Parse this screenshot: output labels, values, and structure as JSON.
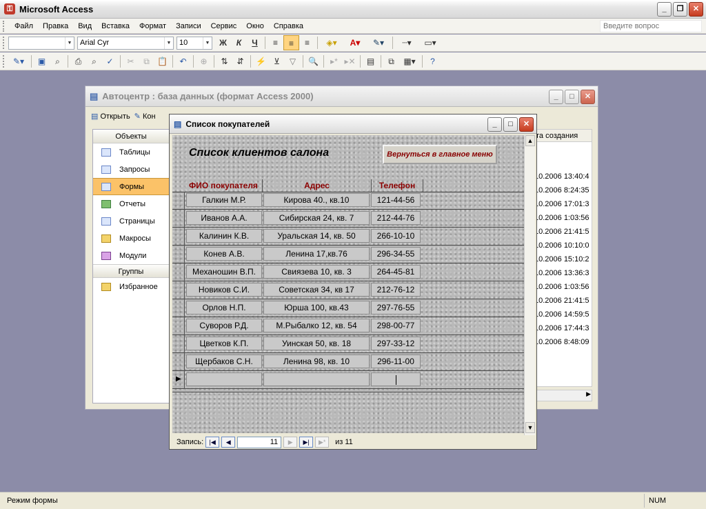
{
  "app": {
    "title": "Microsoft Access"
  },
  "menu": {
    "items": [
      "Файл",
      "Правка",
      "Вид",
      "Вставка",
      "Формат",
      "Записи",
      "Сервис",
      "Окно",
      "Справка"
    ],
    "help_placeholder": "Введите вопрос"
  },
  "format_toolbar": {
    "object_combo": "",
    "font": "Arial Cyr",
    "size": "10",
    "bold": "Ж",
    "italic": "К",
    "underline": "Ч"
  },
  "db_window": {
    "title": "Автоцентр : база данных (формат Access 2000)",
    "open_label": "Открыть",
    "design_label": "Кон",
    "objects_header": "Объекты",
    "objects": [
      "Таблицы",
      "Запросы",
      "Формы",
      "Отчеты",
      "Страницы",
      "Макросы",
      "Модули"
    ],
    "selected_object": "Формы",
    "groups_header": "Группы",
    "groups": [
      "Избранное"
    ],
    "created_header": "та создания",
    "created_dates": [
      "10.2006 13:40:4",
      "10.2006 8:24:35",
      "10.2006 17:01:3",
      "10.2006 1:03:56",
      "10.2006 21:41:5",
      "10.2006 10:10:0",
      "10.2006 15:10:2",
      "10.2006 13:36:3",
      "10.2006 1:03:56",
      "10.2006 21:41:5",
      "10.2006 14:59:5",
      "10.2006 17:44:3",
      "10.2006 8:48:09"
    ]
  },
  "form_window": {
    "title": "Список покупателей",
    "form_heading": "Список клиентов салона",
    "back_button": "Вернуться в главное меню",
    "columns": {
      "name": "ФИО покупателя",
      "address": "Адрес",
      "phone": "Телефон"
    },
    "rows": [
      {
        "name": "Галкин М.Р.",
        "address": "Кирова 40., кв.10",
        "phone": "121-44-56"
      },
      {
        "name": "Иванов А.А.",
        "address": "Сибирская 24, кв. 7",
        "phone": "212-44-76"
      },
      {
        "name": "Калинин К.В.",
        "address": "Уральская 14, кв. 50",
        "phone": "266-10-10"
      },
      {
        "name": "Конев А.В.",
        "address": "Ленина 17,кв.76",
        "phone": "296-34-55"
      },
      {
        "name": "Механошин В.П.",
        "address": "Свиязева 10, кв. 3",
        "phone": "264-45-81"
      },
      {
        "name": "Новиков С.И.",
        "address": "Советская 34, кв 17",
        "phone": "212-76-12"
      },
      {
        "name": "Орлов Н.П.",
        "address": "Юрша 100, кв.43",
        "phone": "297-76-55"
      },
      {
        "name": "Суворов Р.Д.",
        "address": "М.Рыбалко 12, кв. 54",
        "phone": "298-00-77"
      },
      {
        "name": "Цветков К.П.",
        "address": "Уинская 50, кв. 18",
        "phone": "297-33-12"
      },
      {
        "name": "Щербаков С.Н.",
        "address": "Ленина 98, кв. 10",
        "phone": "296-11-00"
      }
    ],
    "record_label": "Запись:",
    "current_record": "11",
    "of_label": "из",
    "total_records": "11"
  },
  "status": {
    "mode": "Режим формы",
    "num": "NUM"
  }
}
